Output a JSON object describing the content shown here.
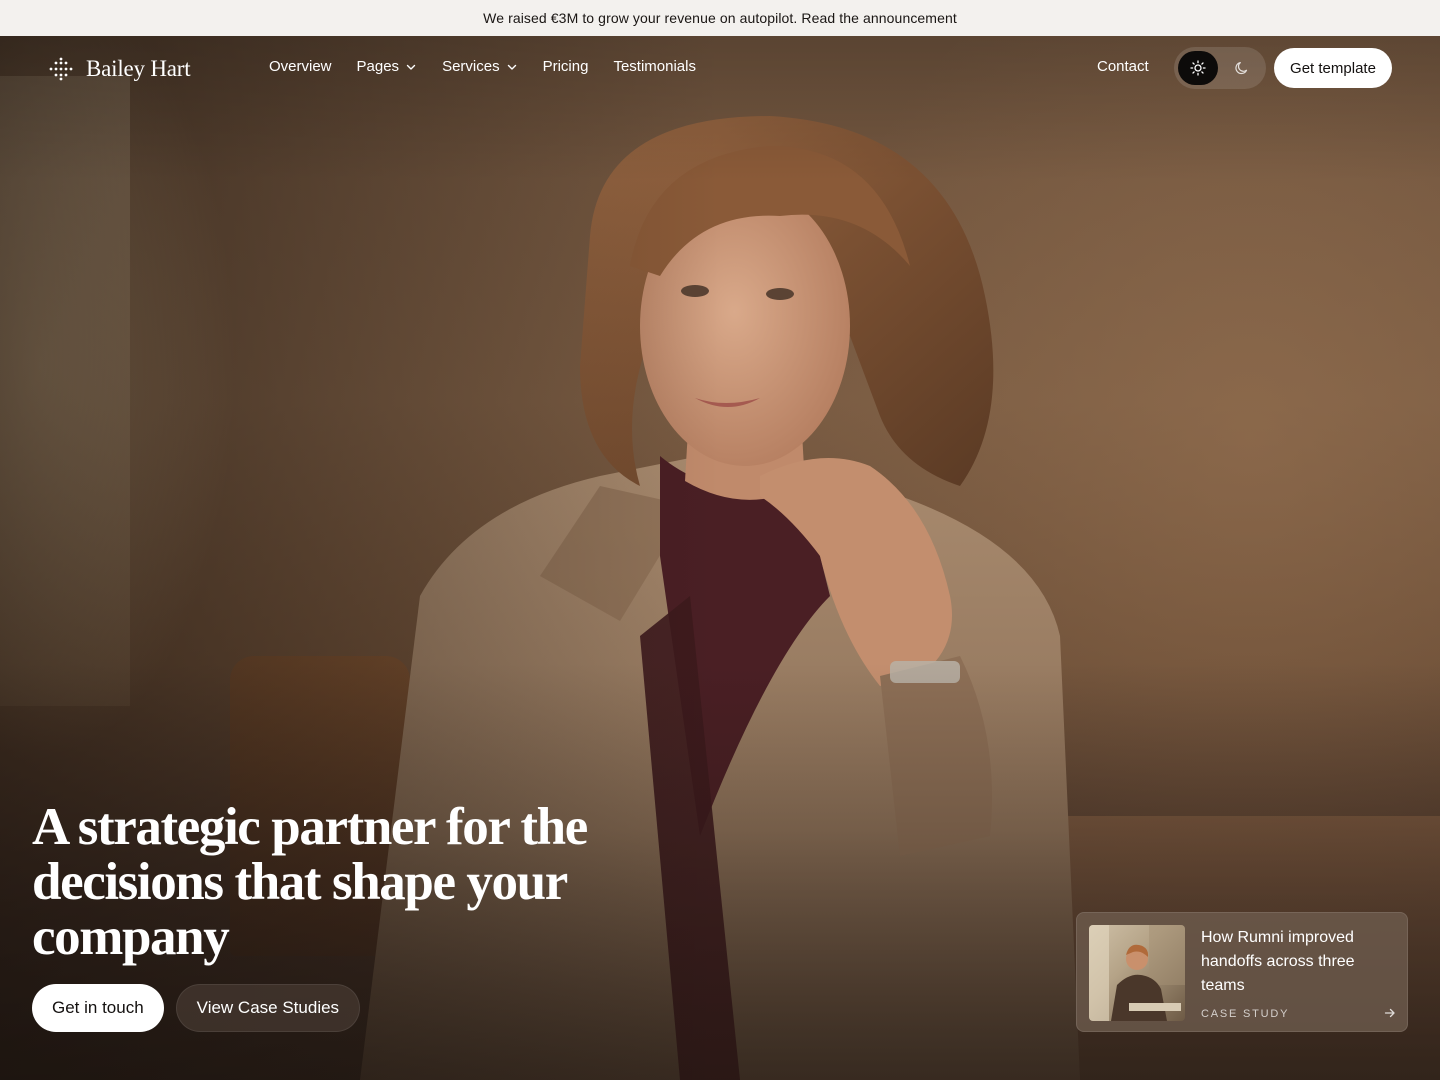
{
  "announcement": {
    "text": "We raised €3M to grow your revenue on autopilot. Read the announcement"
  },
  "brand": {
    "name": "Bailey Hart",
    "logo_icon": "dots-grid-icon"
  },
  "nav": {
    "links": [
      {
        "label": "Overview",
        "has_dropdown": false
      },
      {
        "label": "Pages",
        "has_dropdown": true
      },
      {
        "label": "Services",
        "has_dropdown": true
      },
      {
        "label": "Pricing",
        "has_dropdown": false
      },
      {
        "label": "Testimonials",
        "has_dropdown": false
      }
    ],
    "contact_label": "Contact",
    "theme_toggle": {
      "active": "light",
      "light_icon": "sun-icon",
      "dark_icon": "moon-icon"
    },
    "cta_label": "Get template"
  },
  "hero": {
    "headline": "A strategic partner for the decisions that shape your company",
    "primary_cta": "Get in touch",
    "secondary_cta": "View Case Studies"
  },
  "case_study": {
    "title": "How Rumni improved handoffs across three teams",
    "label": "CASE STUDY",
    "arrow_icon": "arrow-right-icon"
  },
  "colors": {
    "announcement_bg": "#f3f1ee",
    "text_dark": "#141110",
    "button_light": "#ffffff",
    "toggle_active": "#0d0b0a"
  }
}
